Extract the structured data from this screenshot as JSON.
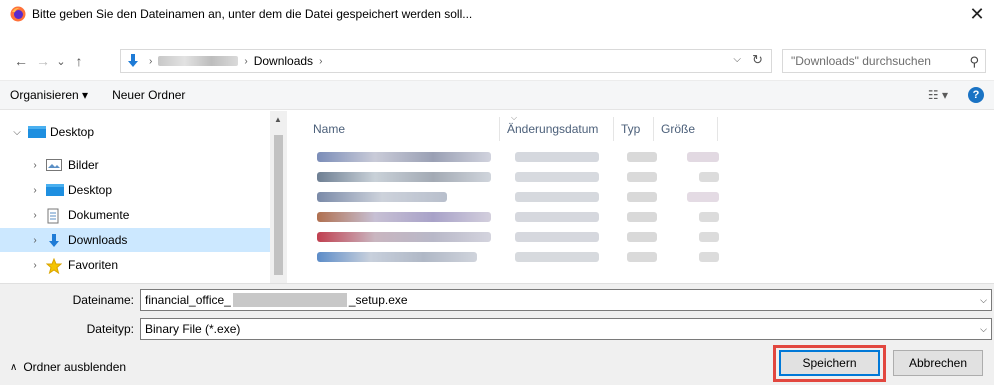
{
  "window": {
    "title": "Bitte geben Sie den Dateinamen an, unter dem die Datei gespeichert werden soll...",
    "close_glyph": "✕"
  },
  "nav": {
    "back_glyph": "←",
    "forward_glyph": "→",
    "recent_glyph": "⌄",
    "up_glyph": "↑"
  },
  "address": {
    "current_folder": "Downloads",
    "sep": "›"
  },
  "search": {
    "placeholder": "\"Downloads\" durchsuchen"
  },
  "toolbar": {
    "organize_label": "Organisieren ▾",
    "new_folder_label": "Neuer Ordner",
    "view_glyph": "☷ ▾",
    "help_glyph": "?"
  },
  "sidebar": {
    "items": [
      {
        "label": "Desktop",
        "icon": "desktop-icon"
      },
      {
        "label": "Bilder",
        "icon": "pictures-icon"
      },
      {
        "label": "Desktop",
        "icon": "desktop-icon"
      },
      {
        "label": "Dokumente",
        "icon": "documents-icon"
      },
      {
        "label": "Downloads",
        "icon": "downloads-icon"
      },
      {
        "label": "Favoriten",
        "icon": "favorites-star-icon"
      }
    ]
  },
  "columns": {
    "name": "Name",
    "modified": "Änderungsdatum",
    "type": "Typ",
    "size": "Größe"
  },
  "form": {
    "filename_label": "Dateiname:",
    "filename_value_prefix": "financial_office_",
    "filename_value_suffix": "_setup.exe",
    "filetype_label": "Dateityp:",
    "filetype_value": "Binary File (*.exe)",
    "toggle_folders_label": "Ordner ausblenden",
    "save_label": "Speichern",
    "cancel_label": "Abbrechen"
  },
  "colors": {
    "selection": "#cce8ff",
    "accent": "#0078d7",
    "highlight": "#e2473f"
  }
}
